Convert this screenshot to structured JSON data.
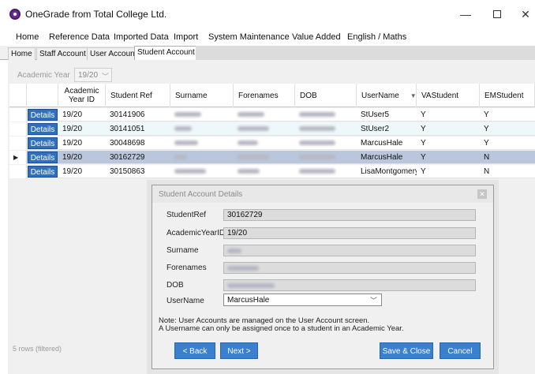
{
  "window": {
    "title": "OneGrade from Total College Ltd."
  },
  "menu": [
    "Home",
    "Reference Data",
    "Imported Data",
    "Import",
    "System Maintenance",
    "Value Added",
    "English / Maths"
  ],
  "tabs": [
    "Home",
    "Staff Account",
    "User Account",
    "Student Account"
  ],
  "filter": {
    "label": "Academic Year",
    "value": "19/20"
  },
  "grid": {
    "columns": [
      "Academic Year ID",
      "Student Ref",
      "Surname",
      "Forenames",
      "DOB",
      "UserName",
      "VAStudent",
      "EMStudent"
    ],
    "details_label": "Details",
    "rows": [
      {
        "year": "19/20",
        "ref": "30141906",
        "username": "StUser5",
        "va": "Y",
        "em": "Y"
      },
      {
        "year": "19/20",
        "ref": "30141051",
        "username": "StUser2",
        "va": "Y",
        "em": "Y"
      },
      {
        "year": "19/20",
        "ref": "30048698",
        "username": "MarcusHale",
        "va": "Y",
        "em": "Y"
      },
      {
        "year": "19/20",
        "ref": "30162729",
        "username": "MarcusHale",
        "va": "Y",
        "em": "N"
      },
      {
        "year": "19/20",
        "ref": "30150863",
        "username": "LisaMontgomery",
        "va": "Y",
        "em": "N"
      }
    ]
  },
  "status": "5 rows (filtered)",
  "dialog": {
    "title": "Student Account Details",
    "labels": {
      "student_ref": "StudentRef",
      "year_id": "AcademicYearID",
      "surname": "Surname",
      "forenames": "Forenames",
      "dob": "DOB",
      "username": "UserName"
    },
    "values": {
      "student_ref": "30162729",
      "year_id": "19/20",
      "username": "MarcusHale"
    },
    "note_line1": "Note: User Accounts are managed on the User Account screen.",
    "note_line2": "A Username can only be assigned once to a student in an Academic Year.",
    "buttons": {
      "back": "< Back",
      "next": "Next >",
      "save_close": "Save & Close",
      "cancel": "Cancel"
    }
  }
}
